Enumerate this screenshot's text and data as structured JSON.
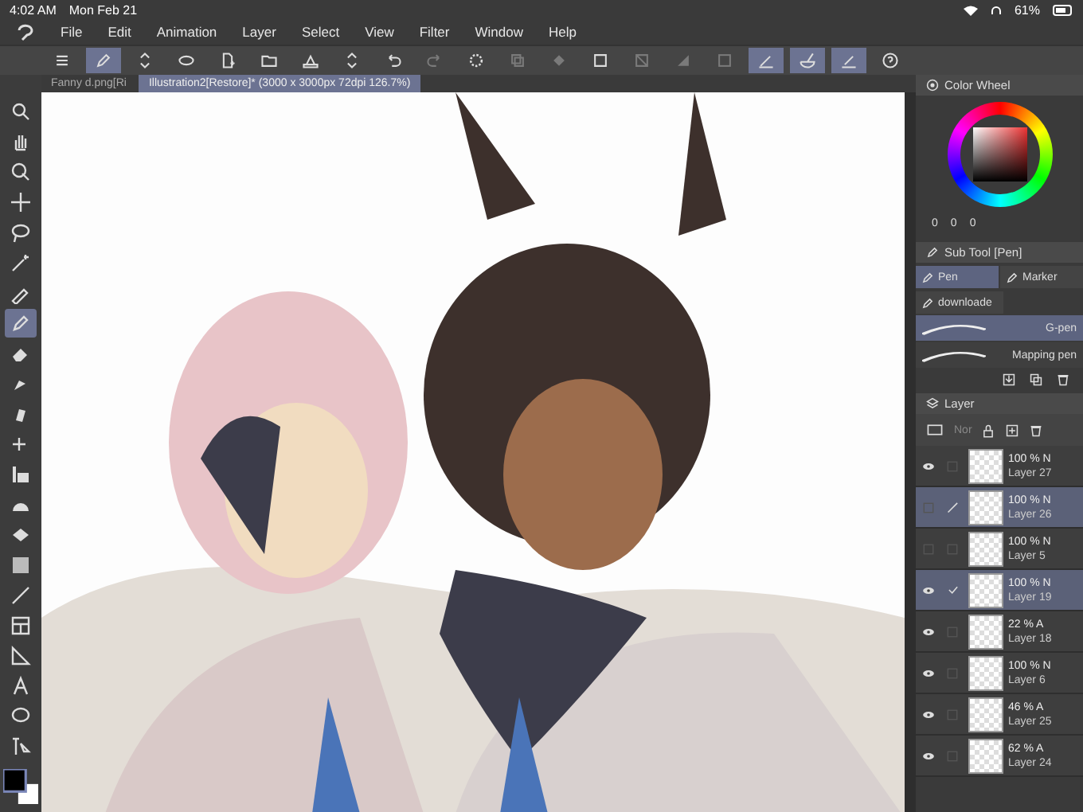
{
  "status_bar": {
    "time": "4:02 AM",
    "date": "Mon Feb 21",
    "battery": "61%"
  },
  "menu": [
    "File",
    "Edit",
    "Animation",
    "Layer",
    "Select",
    "View",
    "Filter",
    "Window",
    "Help"
  ],
  "toolbar": [
    {
      "selected": false,
      "disabled": false
    },
    {
      "selected": true,
      "disabled": false
    },
    {
      "selected": false,
      "disabled": false
    },
    {
      "selected": false,
      "disabled": false
    },
    {
      "selected": false,
      "disabled": false
    },
    {
      "selected": false,
      "disabled": false
    },
    {
      "selected": false,
      "disabled": false
    },
    {
      "selected": false,
      "disabled": false
    },
    {
      "selected": false,
      "disabled": false
    },
    {
      "selected": false,
      "disabled": true
    },
    {
      "selected": false,
      "disabled": false
    },
    {
      "selected": false,
      "disabled": true
    },
    {
      "selected": false,
      "disabled": true
    },
    {
      "selected": false,
      "disabled": false
    },
    {
      "selected": false,
      "disabled": true
    },
    {
      "selected": false,
      "disabled": true
    },
    {
      "selected": false,
      "disabled": true
    },
    {
      "selected": true,
      "disabled": false
    },
    {
      "selected": true,
      "disabled": false
    },
    {
      "selected": true,
      "disabled": false
    },
    {
      "selected": false,
      "disabled": false
    }
  ],
  "document_tabs": [
    {
      "label": "Fanny d.png[Ri",
      "selected": false
    },
    {
      "label": "Illustration2[Restore]* (3000 x 3000px 72dpi 126.7%)",
      "selected": true
    }
  ],
  "tools": [
    {
      "selected": false
    },
    {
      "selected": false
    },
    {
      "selected": false
    },
    {
      "selected": false
    },
    {
      "selected": false
    },
    {
      "selected": false
    },
    {
      "selected": false
    },
    {
      "selected": true
    },
    {
      "selected": false
    },
    {
      "selected": false
    },
    {
      "selected": false
    },
    {
      "selected": false
    },
    {
      "selected": false
    },
    {
      "selected": false
    },
    {
      "selected": false
    },
    {
      "selected": false
    },
    {
      "selected": false
    },
    {
      "selected": false
    },
    {
      "selected": false
    },
    {
      "selected": false
    },
    {
      "selected": false
    },
    {
      "selected": false
    }
  ],
  "color_wheel": {
    "title": "Color Wheel",
    "values": [
      "0",
      "0",
      "0"
    ]
  },
  "sub_tool": {
    "title": "Sub Tool [Pen]",
    "groups": [
      {
        "label": "Pen",
        "selected": true
      },
      {
        "label": "Marker",
        "selected": false
      },
      {
        "label": "downloade",
        "selected": false
      }
    ],
    "brushes": [
      {
        "label": "G-pen",
        "selected": true
      },
      {
        "label": "Mapping pen",
        "selected": false
      }
    ]
  },
  "layer_panel": {
    "title": "Layer",
    "blend_mode": "Nor",
    "layers": [
      {
        "opacity": "100 % N",
        "name": "Layer 27",
        "visible": true,
        "selected": false,
        "current": false
      },
      {
        "opacity": "100 % N",
        "name": "Layer 26",
        "visible": false,
        "selected": true,
        "current": true
      },
      {
        "opacity": "100 % N",
        "name": "Layer 5",
        "visible": false,
        "selected": false,
        "current": false
      },
      {
        "opacity": "100 % N",
        "name": "Layer 19",
        "visible": true,
        "selected": true,
        "current": false
      },
      {
        "opacity": "22 % A",
        "name": "Layer 18",
        "visible": true,
        "selected": false,
        "current": false
      },
      {
        "opacity": "100 % N",
        "name": "Layer 6",
        "visible": true,
        "selected": false,
        "current": false
      },
      {
        "opacity": "46 % A",
        "name": "Layer 25",
        "visible": true,
        "selected": false,
        "current": false
      },
      {
        "opacity": "62 % A",
        "name": "Layer 24",
        "visible": true,
        "selected": false,
        "current": false
      }
    ]
  }
}
